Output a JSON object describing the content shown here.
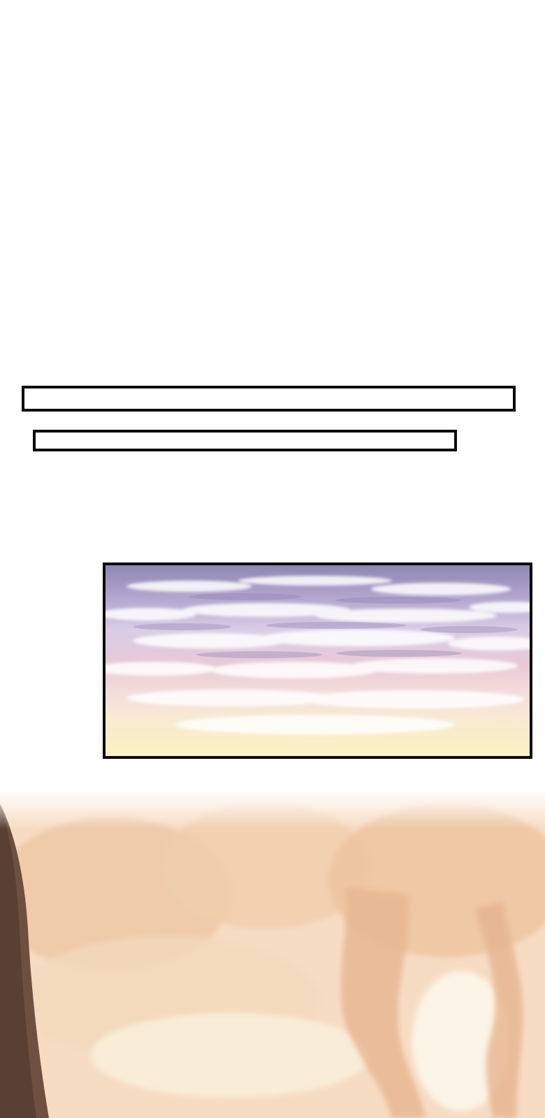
{
  "captions": [
    {
      "text": ""
    },
    {
      "text": ""
    }
  ],
  "panels": [
    {
      "name": "sunset-sky-panel",
      "scene": "sunset-sky-clouds-icon"
    },
    {
      "name": "forest-background",
      "scene": "misty-forest-icon"
    }
  ],
  "colors": {
    "panel_border": "#0a0a0a",
    "sky_top": "#8f86b3",
    "sky_mid": "#e8c9d7",
    "sky_bottom": "#fbf2c2",
    "forest_tone": "#f3c9a6"
  }
}
